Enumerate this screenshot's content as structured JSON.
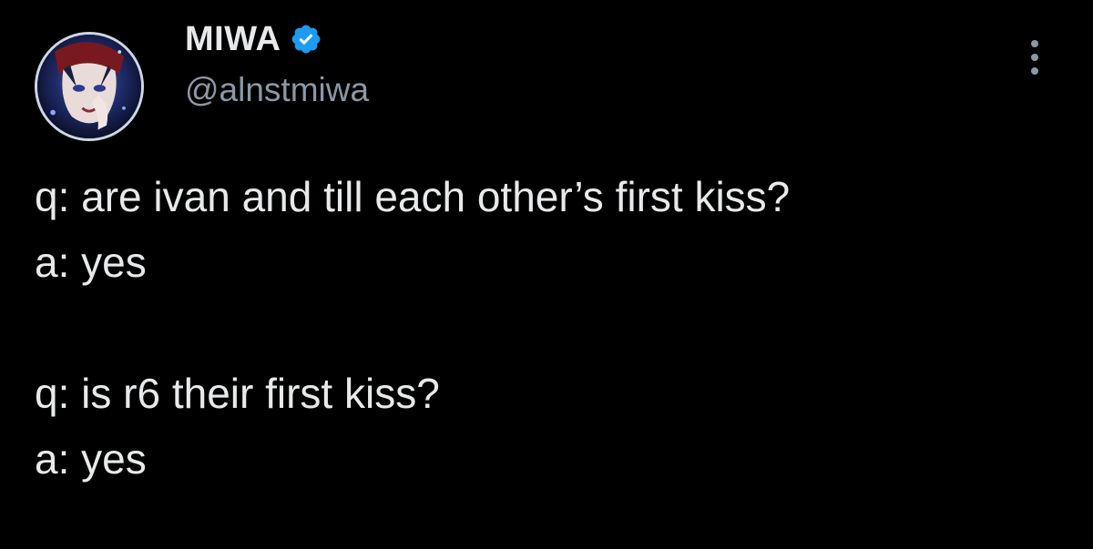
{
  "author": {
    "display_name": "MIWA",
    "handle": "@alnstmiwa",
    "verified": true,
    "avatar_icon": "avatar-anime-character"
  },
  "menu": {
    "icon": "more-options-icon"
  },
  "tweet": {
    "lines": [
      "q: are ivan and till each other’s first kiss?",
      "a: yes",
      "",
      "q: is r6 their first kiss?",
      "a: yes"
    ]
  },
  "colors": {
    "background": "#000000",
    "text": "#e7e9ea",
    "secondary": "#8b98a5",
    "verified": "#1d9bf0"
  }
}
